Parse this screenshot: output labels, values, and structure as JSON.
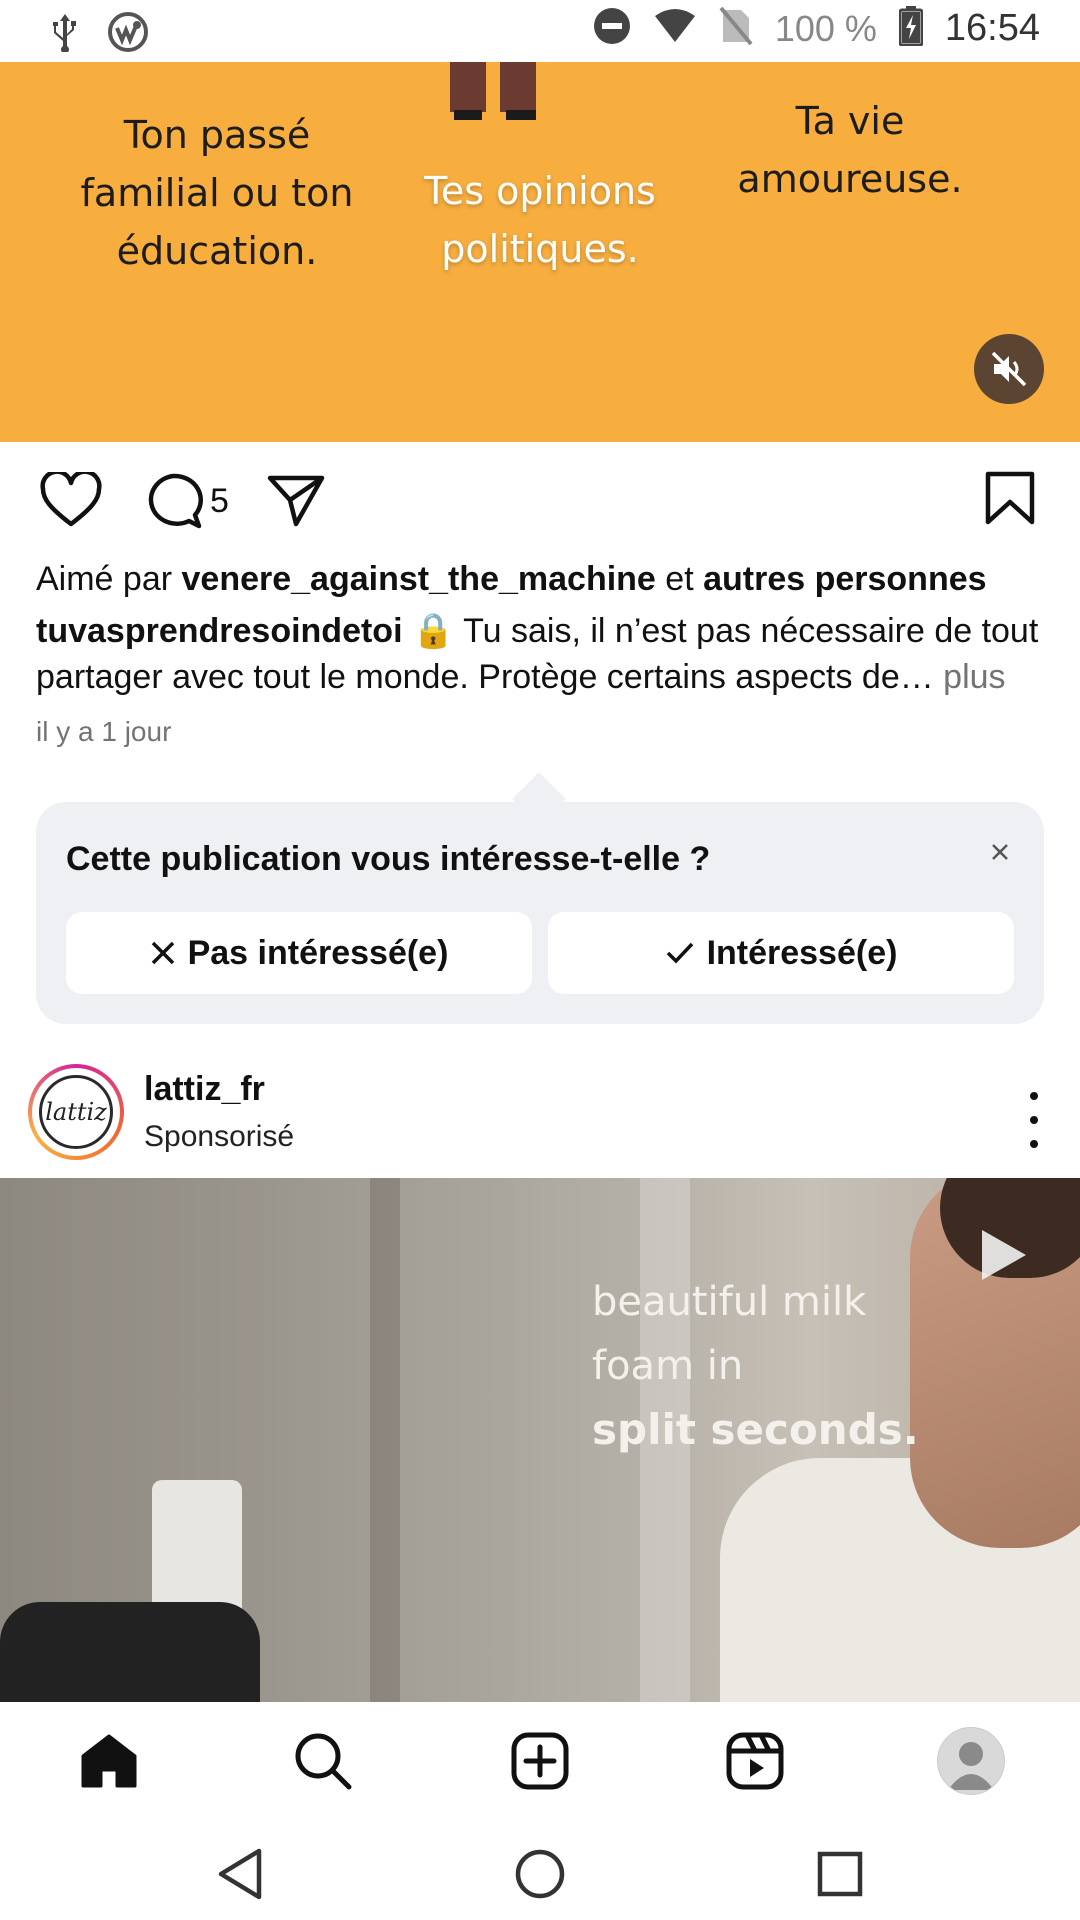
{
  "status_bar": {
    "battery_percent": "100 %",
    "time": "16:54",
    "icons": [
      "usb-icon",
      "app-notification-icon",
      "dnd-icon",
      "wifi-icon",
      "no-sim-icon",
      "battery-charging-icon"
    ]
  },
  "top_post": {
    "media_captions": {
      "left": "Ton passé familial ou ton éducation.",
      "center": "Tes opinions politiques.",
      "right": "Ta vie amoureuse."
    },
    "comment_count": "5",
    "liked_prefix": "Aimé par ",
    "liked_user": "venere_against_the_machine",
    "liked_and": " et ",
    "liked_others": "autres personnes",
    "author": "tuvasprendresoindetoi",
    "lock_emoji": "🔒",
    "caption": " Tu sais, il n’est pas nécessaire de tout partager avec tout le monde. Protège certains aspects de",
    "ellipsis": "…",
    "more_label": " plus",
    "timestamp": "il y a 1 jour"
  },
  "interest_card": {
    "title": "Cette publication vous intéresse-t-elle ?",
    "not_interested_label": "Pas intéressé(e)",
    "interested_label": "Intéressé(e)"
  },
  "sponsored_post": {
    "username": "lattiz_fr",
    "subtitle": "Sponsorisé",
    "logo_text": "lattiz",
    "video_text": {
      "line1": "beautiful milk",
      "line2": "foam in",
      "line3": "split seconds."
    }
  },
  "colors": {
    "orange_media": "#f7ae3f",
    "card_bg": "#eef0f3",
    "link_muted": "#737373"
  }
}
